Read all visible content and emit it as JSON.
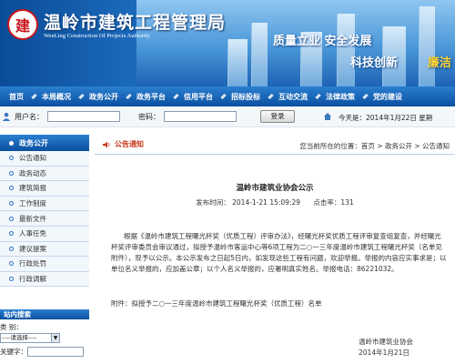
{
  "header": {
    "logo_char": "建",
    "title": "温岭市建筑工程管理局",
    "subtitle": "WenLing Construction Of Projects Authority",
    "slogan_1": "质量立业  安全发展",
    "slogan_2": "科技创新",
    "slogan_3": "廉洁"
  },
  "nav": {
    "items": [
      "首页",
      "本局概况",
      "政务公开",
      "政务平台",
      "信用平台",
      "招标投标",
      "互动交流",
      "法律政策",
      "党的建设"
    ]
  },
  "login": {
    "username_label": "用户名：",
    "password_label": "密码：",
    "login_button": "登录",
    "date_text": "今天是：2014年1月22日 星期"
  },
  "sidebar": {
    "title": "政务公开",
    "items": [
      "公告通知",
      "政务动态",
      "建筑简报",
      "工作制度",
      "最新文件",
      "人事任免",
      "建议提案",
      "行政处罚",
      "行政调解"
    ],
    "search": {
      "title": "站内搜索",
      "category_label": "类  别：",
      "select_value": "----请选择----",
      "keyword_label": "关键字："
    }
  },
  "main": {
    "header_label": "公告通知",
    "breadcrumb": "您当前所在的位置：首页 > 政务公开 > 公告通知",
    "article": {
      "title": "温岭市建筑业协会公示",
      "publish_time": "发布时间：  2014-1-21 15:09:29",
      "hits": "点击率：131",
      "body": "根据《温岭市建筑工程曙光杯奖（优质工程）评审办法》，经曙光杯奖优质工程评审复查组复查，并经曙光杯奖评审委员会审议通过，拟授予温岭市客运中心等6项工程为二○一三年度温岭市建筑工程曙光杯奖（名单见附件），现予以公示。本公示发布之日起5日内，如发现这些工程有问题，欢迎举报。举报的内容应实事求是；以单位名义举报的，应加盖公章；以个人名义举报的，应署明真实姓名。举报电话：86221032。",
      "attachment": "附件：拟授予二○一三年度温岭市建筑工程曙光杯奖（优质工程）名单",
      "signature_org": "温岭市建筑业协会",
      "signature_date": "2014年1月21日"
    }
  }
}
